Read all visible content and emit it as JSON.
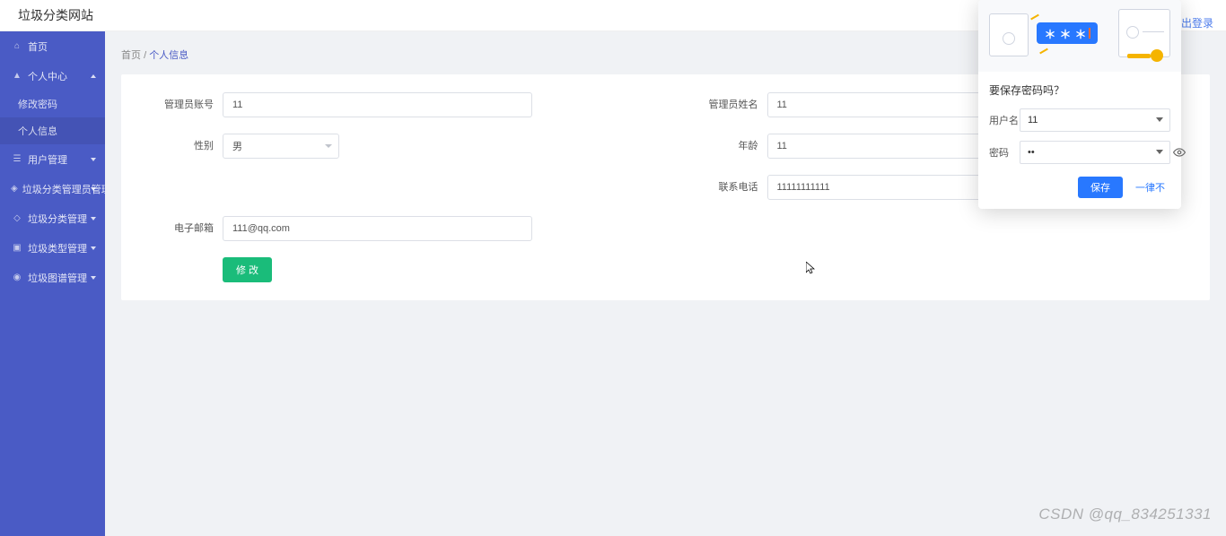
{
  "topbar": {
    "title": "垃圾分类网站",
    "logout": "出登录"
  },
  "sidebar": {
    "home_label": "首页",
    "personal_label": "个人中心",
    "sub_change_pwd": "修改密码",
    "sub_personal_info": "个人信息",
    "user_mgmt": "用户管理",
    "admin_mgmt": "垃圾分类管理员管理",
    "cat_mgmt": "垃圾分类管理",
    "type_mgmt": "垃圾类型管理",
    "img_mgmt": "垃圾图谱管理"
  },
  "breadcrumb": {
    "home": "首页",
    "sep": "/",
    "current": "个人信息"
  },
  "form": {
    "admin_account_label": "管理员账号",
    "admin_account_value": "11",
    "admin_name_label": "管理员姓名",
    "admin_name_value": "11",
    "gender_label": "性别",
    "gender_value": "男",
    "age_label": "年龄",
    "age_value": "11",
    "phone_label": "联系电话",
    "phone_value": "11111111111",
    "email_label": "电子邮箱",
    "email_value": "111@qq.com",
    "submit_label": "修 改"
  },
  "pw_popup": {
    "title": "要保存密码吗？",
    "user_label": "用户名",
    "user_value": "11",
    "pwd_label": "密码",
    "pwd_value": "••",
    "pill_text": "＊＊＊",
    "save": "保存",
    "never": "一律不"
  },
  "watermark": "CSDN @qq_834251331"
}
